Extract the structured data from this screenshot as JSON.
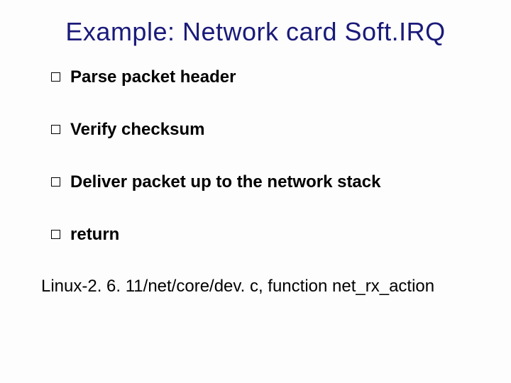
{
  "title": "Example: Network card Soft.IRQ",
  "bullets": [
    {
      "text": "Parse packet header"
    },
    {
      "text": "Verify checksum"
    },
    {
      "text": "Deliver packet up to the network stack"
    },
    {
      "text": "return"
    }
  ],
  "footnote": "Linux-2. 6. 11/net/core/dev. c, function net_rx_action"
}
